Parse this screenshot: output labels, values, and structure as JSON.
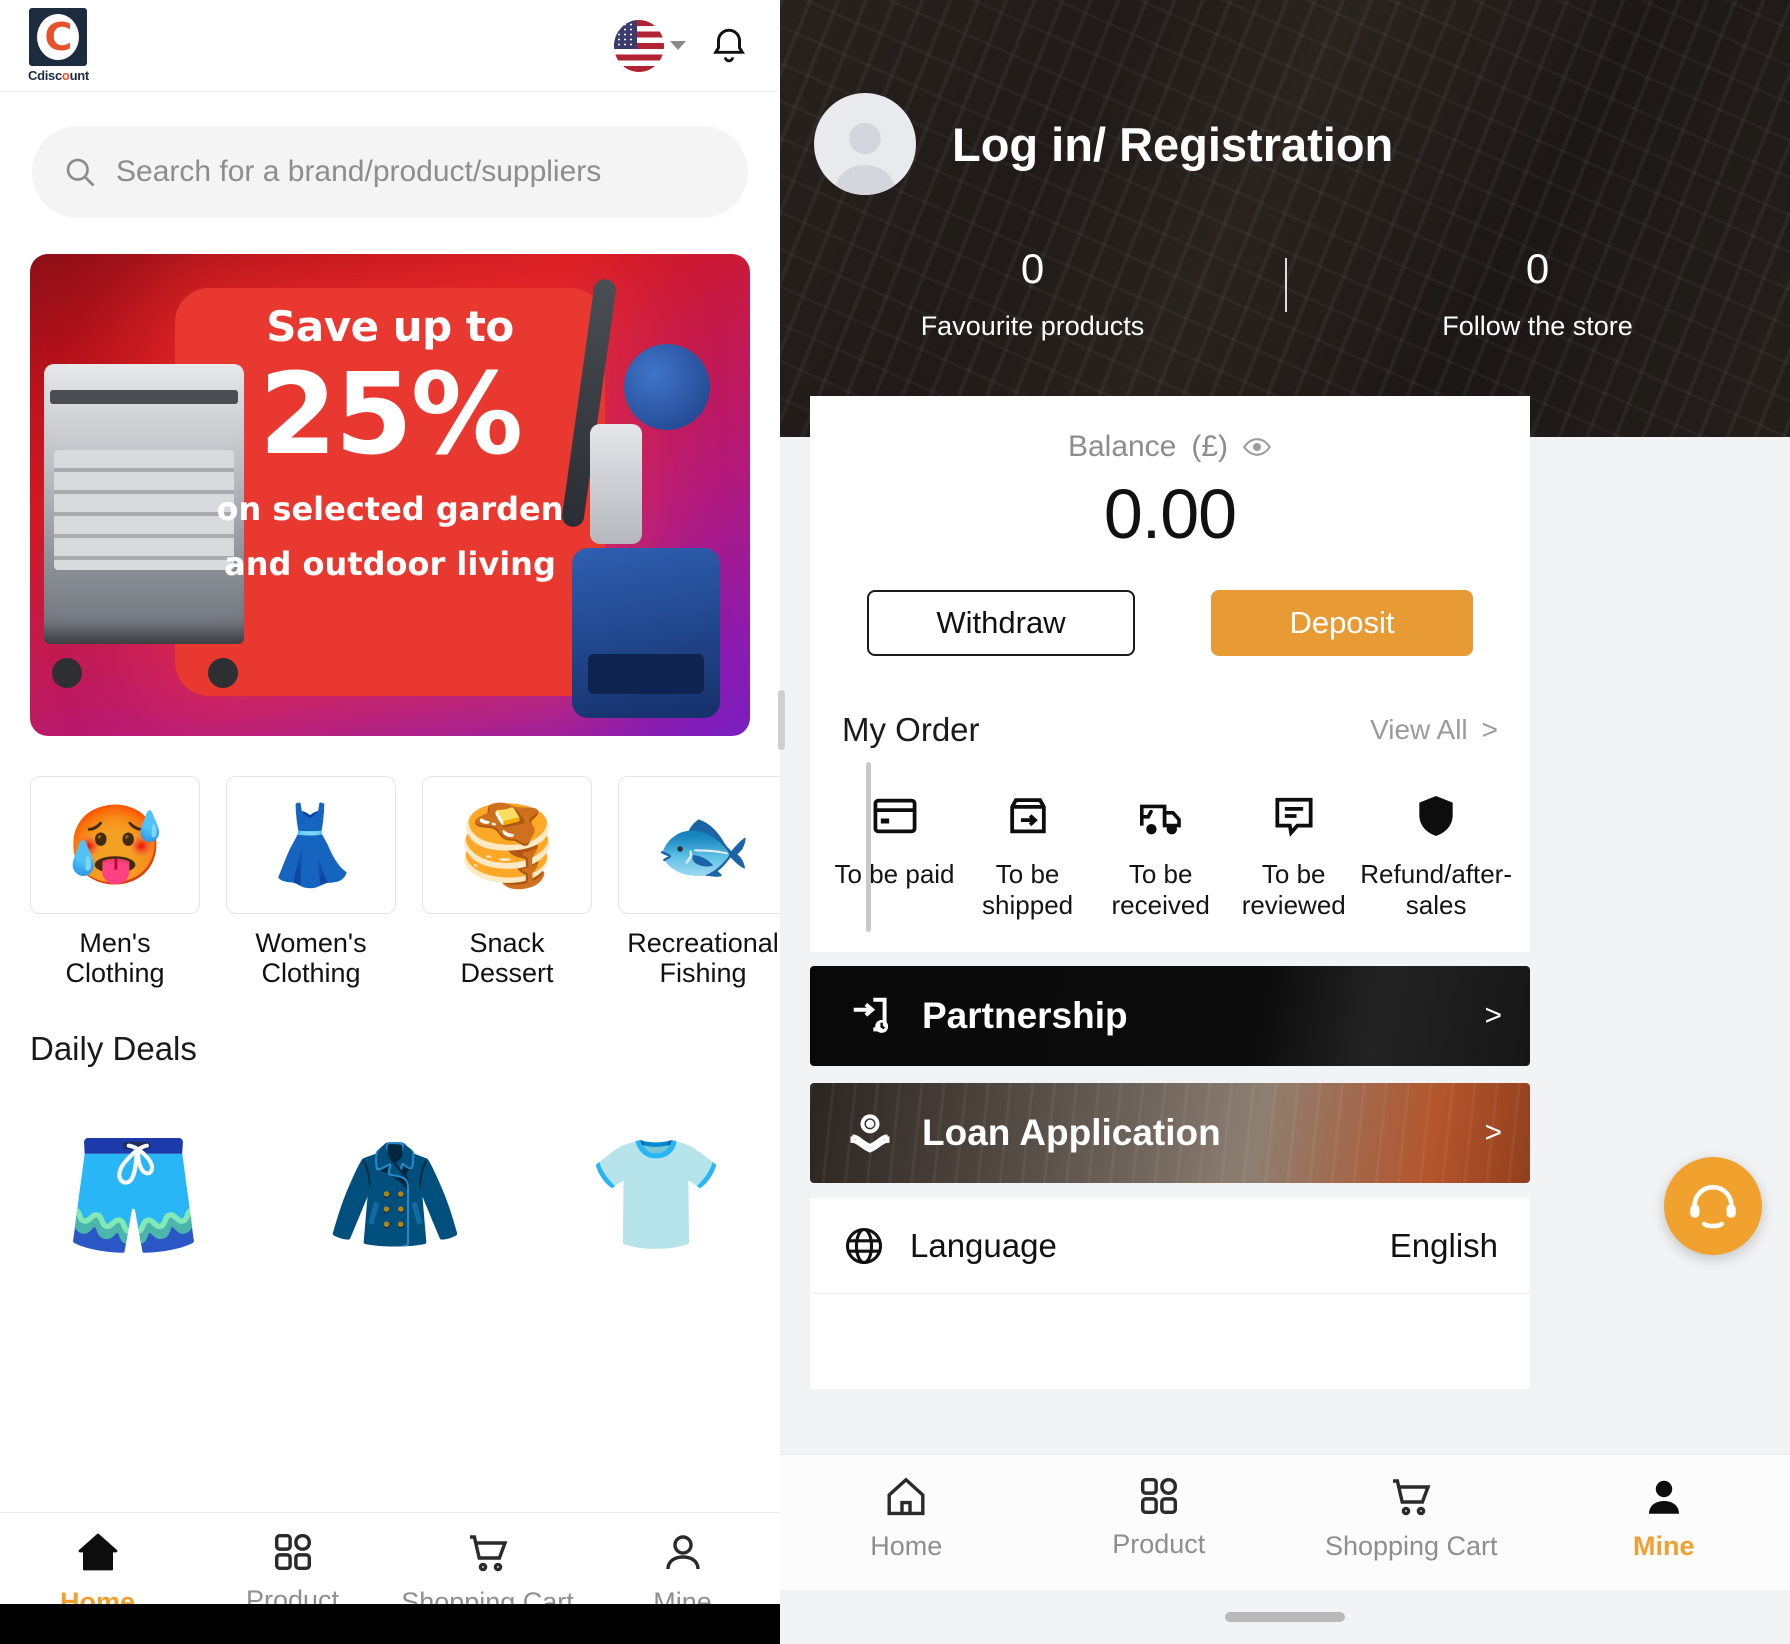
{
  "left": {
    "header": {
      "logo_letter": "C",
      "logo_text_a": "Cdisc",
      "logo_text_b": "o",
      "logo_text_c": "unt",
      "flag_icon": "us-flag-icon",
      "chevron_icon": "chevron-down-icon",
      "bell_icon": "notification-bell-icon"
    },
    "search": {
      "placeholder": "Search for a brand/product/suppliers",
      "icon": "search-icon"
    },
    "banner": {
      "line1": "Save up to",
      "line2": "25%",
      "line3": "on selected garden",
      "line4": "and outdoor living"
    },
    "categories": [
      {
        "label": "Men's Clothing",
        "emoji": "🥵"
      },
      {
        "label": "Women's Clothing",
        "emoji": "👗"
      },
      {
        "label": "Snack Dessert",
        "emoji": "🥞"
      },
      {
        "label": "Recreational Fishing",
        "emoji": "🐟"
      }
    ],
    "deals_title": "Daily Deals",
    "deals": [
      {
        "emoji": "🩳"
      },
      {
        "emoji": "🧥"
      },
      {
        "emoji": "👕"
      }
    ],
    "tabs": [
      {
        "label": "Home",
        "icon": "home-icon",
        "active": true
      },
      {
        "label": "Product",
        "icon": "grid-icon",
        "active": false
      },
      {
        "label": "Shopping Cart",
        "icon": "cart-icon",
        "active": false
      },
      {
        "label": "Mine",
        "icon": "person-icon",
        "active": false
      }
    ]
  },
  "right": {
    "hero": {
      "title": "Log in/ Registration",
      "avatar_icon": "avatar-placeholder-icon",
      "stats": [
        {
          "value": "0",
          "label": "Favourite products"
        },
        {
          "value": "0",
          "label": "Follow the store"
        }
      ]
    },
    "balance": {
      "label": "Balance (£)",
      "eye_icon": "eye-icon",
      "amount": "0.00",
      "withdraw_label": "Withdraw",
      "deposit_label": "Deposit"
    },
    "order": {
      "title": "My Order",
      "view_all": "View All",
      "view_all_arrow": ">",
      "items": [
        {
          "label": "To be paid",
          "icon": "credit-card-icon"
        },
        {
          "label": "To be shipped",
          "icon": "package-out-icon"
        },
        {
          "label": "To be received",
          "icon": "delivery-truck-icon"
        },
        {
          "label": "To be reviewed",
          "icon": "comment-review-icon"
        },
        {
          "label": "Refund/after-sales",
          "icon": "shield-refund-icon"
        }
      ]
    },
    "promos": [
      {
        "label": "Partnership",
        "icon": "partnership-icon",
        "arrow": ">"
      },
      {
        "label": "Loan Application",
        "icon": "loan-hand-icon",
        "arrow": ">"
      }
    ],
    "language": {
      "label": "Language",
      "value": "English",
      "icon": "globe-icon"
    },
    "support_fab": {
      "icon": "headset-support-icon"
    },
    "tabs": [
      {
        "label": "Home",
        "icon": "home-icon",
        "active": false
      },
      {
        "label": "Product",
        "icon": "grid-icon",
        "active": false
      },
      {
        "label": "Shopping Cart",
        "icon": "cart-icon",
        "active": false
      },
      {
        "label": "Mine",
        "icon": "person-icon",
        "active": true
      }
    ]
  },
  "colors": {
    "accent_orange": "#f0a030",
    "deposit_orange": "#e89b34",
    "brand_navy": "#1d2b3f",
    "brand_red": "#e8502a"
  }
}
